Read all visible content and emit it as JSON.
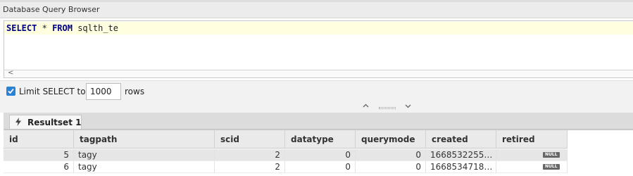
{
  "window": {
    "title": "Database Query Browser"
  },
  "editor": {
    "kw_select": "SELECT",
    "star": "*",
    "kw_from": "FROM",
    "table": "sqlth_te",
    "scroll_left": "<"
  },
  "limit": {
    "checked": true,
    "label": "Limit SELECT to:",
    "value": "1000",
    "unit": "rows"
  },
  "splitter": {
    "up": "^",
    "down": "v"
  },
  "tabs": [
    {
      "label": "Resultset 1",
      "icon": "bolt-icon"
    }
  ],
  "table": {
    "columns": [
      "id",
      "tagpath",
      "scid",
      "datatype",
      "querymode",
      "created",
      "retired"
    ],
    "rows": [
      [
        "5",
        "tagy",
        "2",
        "0",
        "0",
        "1668532255…",
        "NULL"
      ],
      [
        "6",
        "tagy",
        "2",
        "0",
        "0",
        "1668534718…",
        "NULL"
      ]
    ]
  }
}
